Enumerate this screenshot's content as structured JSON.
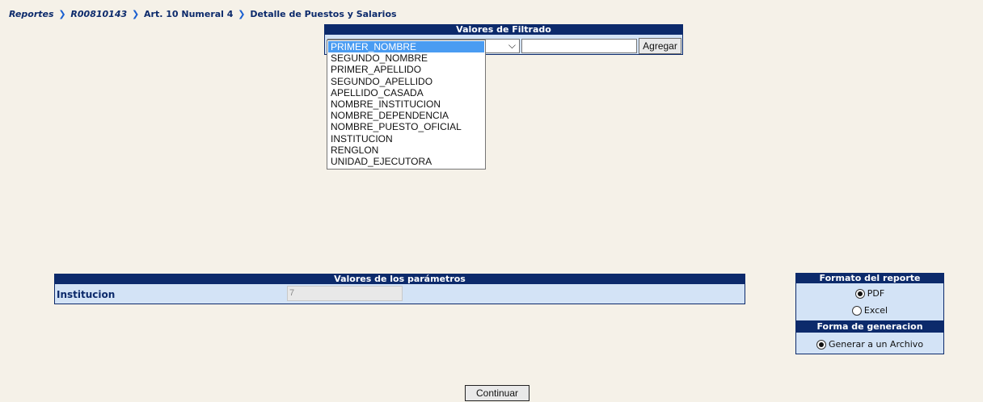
{
  "breadcrumb": {
    "items": [
      "Reportes",
      "R00810143",
      "Art. 10 Numeral 4",
      "Detalle de Puestos y Salarios"
    ]
  },
  "filter": {
    "title": "Valores de Filtrado",
    "selected": "PRIMER_NOMBRE",
    "text_value": "",
    "add_button": "Agregar",
    "options": [
      "PRIMER_NOMBRE",
      "SEGUNDO_NOMBRE",
      "PRIMER_APELLIDO",
      "SEGUNDO_APELLIDO",
      "APELLIDO_CASADA",
      "NOMBRE_INSTITUCION",
      "NOMBRE_DEPENDENCIA",
      "NOMBRE_PUESTO_OFICIAL",
      "INSTITUCION",
      "RENGLON",
      "UNIDAD_EJECUTORA"
    ]
  },
  "params": {
    "title": "Valores de los parámetros",
    "label": "Institucion",
    "value": "7"
  },
  "format": {
    "title": "Formato del reporte",
    "options": [
      "PDF",
      "Excel"
    ],
    "selected": "PDF"
  },
  "generation": {
    "title": "Forma de generacion",
    "option": "Generar a un Archivo",
    "selected": true
  },
  "continue_button": "Continuar",
  "colors": {
    "page_bg": "#f5f1e8",
    "header_bg": "#0c2a6b",
    "panel_bg": "#d3e3f6",
    "selection": "#4a9cf2"
  }
}
